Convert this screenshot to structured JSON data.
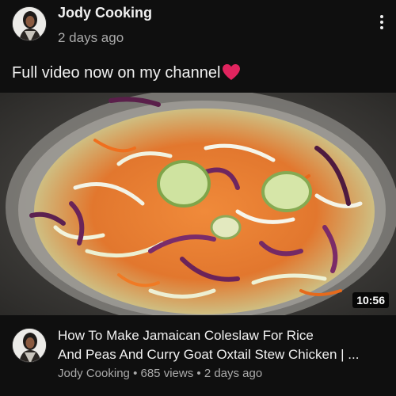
{
  "post": {
    "channel_name": "Jody Cooking",
    "time_ago": "2 days ago",
    "text": "Full video now on my channel",
    "emoji": "heart"
  },
  "video": {
    "duration": "10:56",
    "title_line1": "How To Make Jamaican Coleslaw For Rice",
    "title_line2": "And Peas And Curry Goat Oxtail Stew Chicken | ...",
    "channel_name": "Jody Cooking",
    "views": "685 views",
    "time_ago": "2 days ago",
    "separator": "•"
  },
  "icons": {
    "menu": "more-vert-icon",
    "reaction": "red-heart-icon"
  },
  "colors": {
    "background": "#0f0f0f",
    "primary_text": "#f1f1f1",
    "secondary_text": "#aaaaaa",
    "heart": "#e0245e"
  }
}
